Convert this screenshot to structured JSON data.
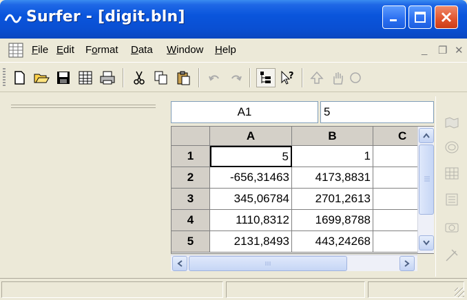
{
  "window": {
    "title": "Surfer - [digit.bln]",
    "app_icon": "surfer-wave-icon",
    "controls": [
      "minimize",
      "maximize",
      "close"
    ]
  },
  "menubar": {
    "items": [
      {
        "label": "File",
        "accel": "F"
      },
      {
        "label": "Edit",
        "accel": "E"
      },
      {
        "label": "Format",
        "accel": "o"
      },
      {
        "label": "Data",
        "accel": "D"
      },
      {
        "label": "Window",
        "accel": "W"
      },
      {
        "label": "Help",
        "accel": "H"
      }
    ],
    "mdi_controls": [
      "_",
      "❐",
      "✕"
    ]
  },
  "toolbar": {
    "buttons": [
      "new-file-icon",
      "open-folder-icon",
      "save-icon",
      "worksheet-icon",
      "print-icon",
      "cut-icon",
      "copy-icon",
      "paste-icon",
      "undo-icon",
      "redo-icon",
      "object-manager-icon",
      "context-help-icon",
      "arrow-up-icon",
      "pan-hand-icon",
      "zoom-icon"
    ]
  },
  "editor": {
    "cell_reference": "A1",
    "cell_value": "5"
  },
  "worksheet": {
    "columns": [
      "A",
      "B",
      "C"
    ],
    "rows": [
      {
        "num": "1",
        "a": "5",
        "b": "1"
      },
      {
        "num": "2",
        "a": "-656,31463",
        "b": "4173,8831"
      },
      {
        "num": "3",
        "a": "345,06784",
        "b": "2701,2613"
      },
      {
        "num": "4",
        "a": "1110,8312",
        "b": "1699,8788"
      },
      {
        "num": "5",
        "a": "2131,8493",
        "b": "443,24268"
      }
    ],
    "active_cell": "A1"
  },
  "right_toolbar": {
    "buttons": [
      "map-icon",
      "contour-icon",
      "grid-icon",
      "list-icon",
      "camera-icon",
      "digitize-icon"
    ]
  },
  "colors": {
    "titlebar": "#0a55dc",
    "close_button": "#e0532c",
    "chrome": "#ece9d8"
  }
}
